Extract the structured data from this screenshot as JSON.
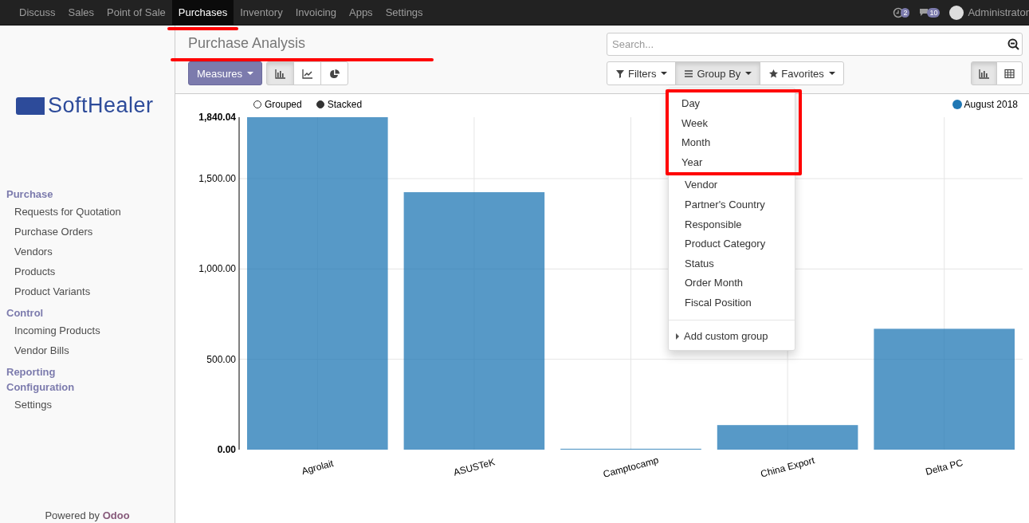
{
  "navbar": {
    "apps": [
      {
        "label": "Discuss",
        "selected": false,
        "annotated": false
      },
      {
        "label": "Sales",
        "selected": false,
        "annotated": false
      },
      {
        "label": "Point of Sale",
        "selected": false,
        "annotated": false
      },
      {
        "label": "Purchases",
        "selected": true,
        "annotated": true
      },
      {
        "label": "Inventory",
        "selected": false,
        "annotated": false
      },
      {
        "label": "Invoicing",
        "selected": false,
        "annotated": false
      },
      {
        "label": "Apps",
        "selected": false,
        "annotated": false
      },
      {
        "label": "Settings",
        "selected": false,
        "annotated": false
      }
    ],
    "activity_count": "2",
    "message_count": "10",
    "user": "Administrator"
  },
  "sidebar": {
    "logo": "SoftHealer",
    "sections": [
      {
        "title": "Purchase",
        "items": [
          "Requests for Quotation",
          "Purchase Orders",
          "Vendors",
          "Products",
          "Product Variants"
        ]
      },
      {
        "title": "Control",
        "items": [
          "Incoming Products",
          "Vendor Bills"
        ]
      },
      {
        "title": "Reporting"
      },
      {
        "title": "Configuration",
        "items": [
          "Settings"
        ]
      }
    ],
    "footer_prefix": "Powered by",
    "footer_brand": "Odoo"
  },
  "breadcrumb": {
    "title": "Purchase Analysis",
    "annotated": true
  },
  "control_panel": {
    "measures": "Measures",
    "chart_types": [
      {
        "kind": "bar",
        "selected": true
      },
      {
        "kind": "line",
        "selected": false
      },
      {
        "kind": "pie",
        "selected": false
      }
    ],
    "search": {
      "placeholder": "Search..."
    },
    "search_buttons": [
      {
        "kind": "filter",
        "label": "Filters",
        "selected": false
      },
      {
        "kind": "group",
        "label": "Group By",
        "selected": true
      },
      {
        "kind": "star",
        "label": "Favorites",
        "selected": false
      }
    ],
    "views": [
      {
        "kind": "graph",
        "selected": true
      },
      {
        "kind": "pivot",
        "selected": false
      }
    ]
  },
  "groupby_menu": {
    "items": [
      {
        "label": "Day",
        "annotated": true
      },
      {
        "label": "Week",
        "annotated": true
      },
      {
        "label": "Month",
        "annotated": true
      },
      {
        "label": "Year",
        "annotated": true
      },
      {
        "label": "Vendor",
        "annotated": false
      },
      {
        "label": "Partner's Country",
        "annotated": false
      },
      {
        "label": "Responsible",
        "annotated": false
      },
      {
        "label": "Product Category",
        "annotated": false
      },
      {
        "label": "Status",
        "annotated": false
      },
      {
        "label": "Order Month",
        "annotated": false
      },
      {
        "label": "Fiscal Position",
        "annotated": false
      }
    ],
    "custom": "Add custom group"
  },
  "graph": {
    "modes": [
      {
        "label": "Grouped",
        "selected": false
      },
      {
        "label": "Stacked",
        "selected": true
      }
    ],
    "chart_data": {
      "type": "bar",
      "categories": [
        "Agrolait",
        "ASUSTeK",
        "Camptocamp",
        "China Export",
        "Delta PC"
      ],
      "series": [
        {
          "name": "August 2018",
          "color": "#1f77b4",
          "values": [
            1840.04,
            1425,
            5,
            136,
            669
          ]
        }
      ],
      "ylim": [
        0,
        1840.04
      ],
      "grid": true,
      "yticks": [
        {
          "value": 0,
          "label": "0.00"
        },
        {
          "value": 500,
          "label": "500.00"
        },
        {
          "value": 1000,
          "label": "1,000.00"
        },
        {
          "value": 1500,
          "label": "1,500.00"
        },
        {
          "value": 1840.04,
          "label": "1,840.04"
        }
      ]
    }
  }
}
